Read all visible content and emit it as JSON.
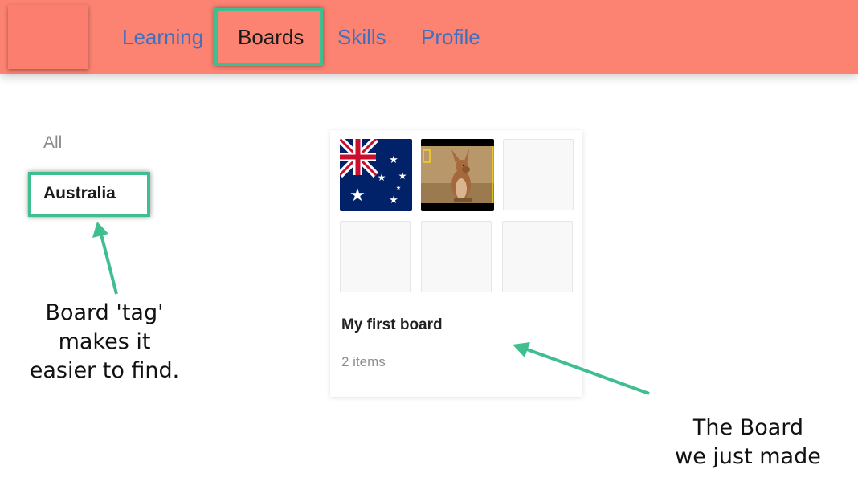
{
  "nav": {
    "items": [
      {
        "label": "Learning"
      },
      {
        "label": "Boards"
      },
      {
        "label": "Skills"
      },
      {
        "label": "Profile"
      }
    ]
  },
  "tags": {
    "all": "All",
    "australia": "Australia"
  },
  "board": {
    "title": "My first board",
    "count": "2 items",
    "images": [
      "australian-flag",
      "wallaby-photo"
    ]
  },
  "annotations": {
    "tag_note": [
      "Board 'tag'",
      "makes it",
      "easier to find."
    ],
    "board_note": [
      "The Board",
      "we just made"
    ]
  },
  "colors": {
    "header": "#fc8272",
    "nav_link": "#3f6fbf",
    "highlight": "#3fbf8f"
  }
}
